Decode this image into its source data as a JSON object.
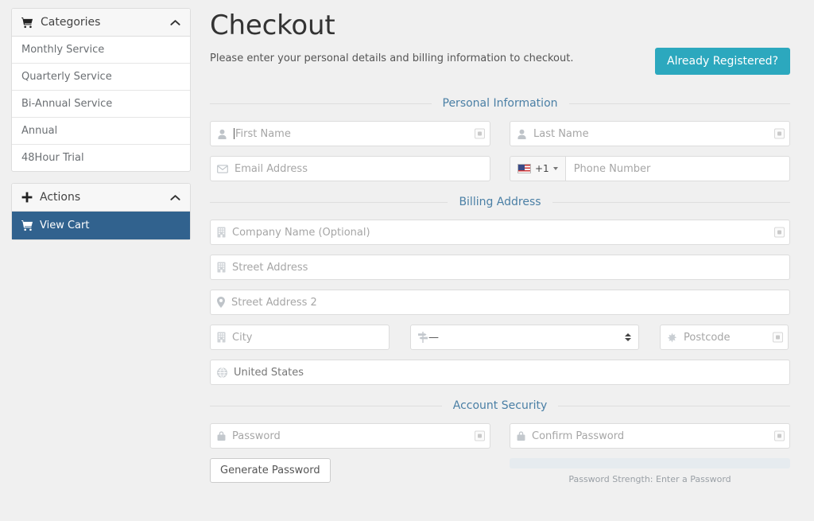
{
  "sidebar": {
    "categories_panel": {
      "title": "Categories",
      "icon": "shopping-cart-icon",
      "caret": "chevron-up-icon",
      "items": [
        {
          "label": "Monthly Service"
        },
        {
          "label": "Quarterly Service"
        },
        {
          "label": "Bi-Annual Service"
        },
        {
          "label": "Annual"
        },
        {
          "label": "48Hour Trial"
        }
      ]
    },
    "actions_panel": {
      "title": "Actions",
      "icon": "plus-icon",
      "caret": "chevron-up-icon",
      "items": [
        {
          "label": "View Cart",
          "icon": "shopping-cart-icon",
          "active": true
        }
      ]
    }
  },
  "main": {
    "title": "Checkout",
    "lead": "Please enter your personal details and billing information to checkout.",
    "registered_button": "Already Registered?",
    "sections": {
      "personal": "Personal Information",
      "billing": "Billing Address",
      "security": "Account Security"
    },
    "fields": {
      "first_name": {
        "placeholder": "First Name",
        "value": "",
        "icon": "user-icon"
      },
      "last_name": {
        "placeholder": "Last Name",
        "value": "",
        "icon": "user-icon"
      },
      "email": {
        "placeholder": "Email Address",
        "value": "",
        "icon": "envelope-icon"
      },
      "phone": {
        "placeholder": "Phone Number",
        "value": "",
        "country_code": "+1",
        "flag": "us-flag-icon"
      },
      "company": {
        "placeholder": "Company Name (Optional)",
        "value": "",
        "icon": "building-icon"
      },
      "street1": {
        "placeholder": "Street Address",
        "value": "",
        "icon": "building-icon"
      },
      "street2": {
        "placeholder": "Street Address 2",
        "value": "",
        "icon": "map-marker-icon"
      },
      "city": {
        "placeholder": "City",
        "value": "",
        "icon": "building-icon"
      },
      "state": {
        "value": "—",
        "icon": "map-signs-icon"
      },
      "postcode": {
        "placeholder": "Postcode",
        "value": "",
        "icon": "asterisk-icon"
      },
      "country": {
        "value": "United States",
        "icon": "globe-icon"
      },
      "password": {
        "placeholder": "Password",
        "value": "",
        "icon": "lock-icon"
      },
      "confirm_password": {
        "placeholder": "Confirm Password",
        "value": "",
        "icon": "lock-icon"
      }
    },
    "generate_password_button": "Generate Password",
    "password_strength_text": "Password Strength: Enter a Password"
  },
  "colors": {
    "accent_teal": "#2ca8be",
    "accent_blue": "#31628e",
    "section_label": "#4a7fa5",
    "page_bg": "#f0f0f0"
  }
}
